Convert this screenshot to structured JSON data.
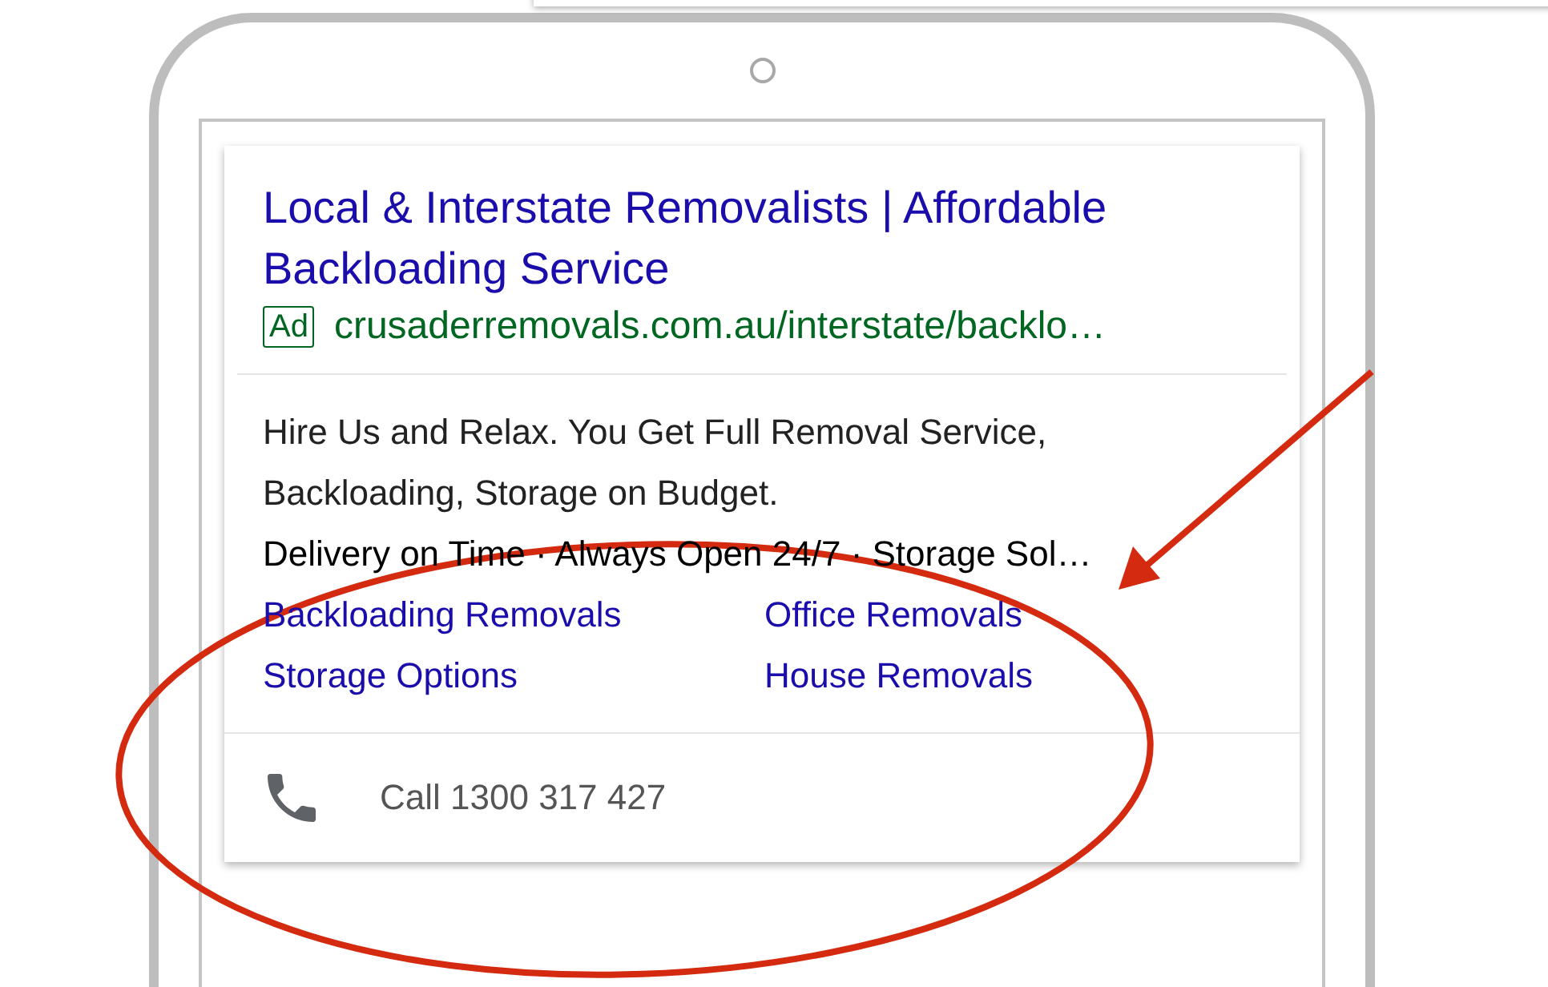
{
  "ad": {
    "title": "Local & Interstate Removalists | Affordable Backloading Service",
    "badge": "Ad",
    "url": "crusaderremovals.com.au/interstate/backlo…",
    "description": "Hire Us and Relax. You Get Full Removal Service, Backloading, Storage on Budget.",
    "callouts": "Delivery on Time · Always Open 24/7 · Storage Sol…",
    "sitelinks": [
      {
        "label": "Backloading Removals"
      },
      {
        "label": "Office Removals"
      },
      {
        "label": "Storage Options"
      },
      {
        "label": "House Removals"
      }
    ],
    "call": "Call 1300 317 427"
  }
}
